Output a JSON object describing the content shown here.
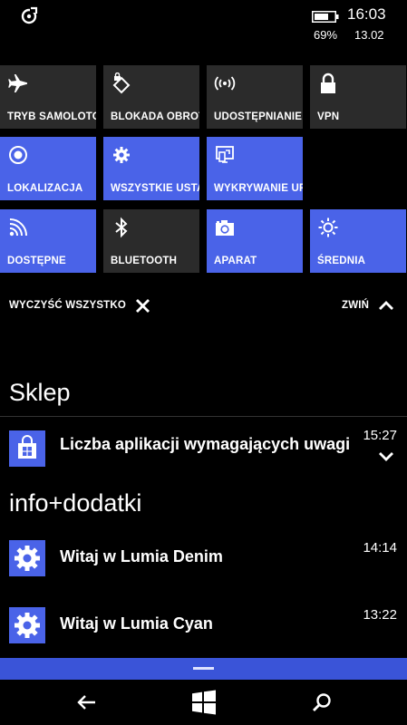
{
  "status": {
    "time": "16:03",
    "battery_pct": "69%",
    "date": "13.02"
  },
  "tiles": [
    {
      "label": "TRYB SAMOLOTOWY",
      "icon": "airplane-icon",
      "color": "gray"
    },
    {
      "label": "BLOKADA OBROTU",
      "icon": "rotation-lock-icon",
      "color": "gray"
    },
    {
      "label": "UDOSTĘPNIANIE",
      "icon": "hotspot-icon",
      "color": "gray"
    },
    {
      "label": "VPN",
      "icon": "lock-icon",
      "color": "gray"
    },
    {
      "label": "LOKALIZACJA",
      "icon": "location-icon",
      "color": "blue"
    },
    {
      "label": "WSZYSTKIE USTAWIENIA",
      "icon": "settings-gear-icon",
      "color": "blue"
    },
    {
      "label": "WYKRYWANIE URZĄDZEŃ",
      "icon": "project-screen-icon",
      "color": "blue"
    },
    {
      "label": "DOSTĘPNE",
      "icon": "wifi-icon",
      "color": "blue"
    },
    {
      "label": "BLUETOOTH",
      "icon": "bluetooth-icon",
      "color": "gray"
    },
    {
      "label": "APARAT",
      "icon": "camera-icon",
      "color": "blue"
    },
    {
      "label": "ŚREDNIA",
      "icon": "brightness-icon",
      "color": "blue"
    }
  ],
  "actions": {
    "clear_all": "WYCZYŚĆ WSZYSTKO",
    "collapse": "ZWIŃ"
  },
  "groups": [
    {
      "title": "Sklep",
      "items": [
        {
          "text": "Liczba aplikacji wymagających uwagi",
          "time": "15:27",
          "icon": "store-bag-icon"
        }
      ]
    },
    {
      "title": "info+dodatki",
      "items": [
        {
          "text": "Witaj w Lumia Denim",
          "time": "14:14",
          "icon": "gear-icon"
        },
        {
          "text": "Witaj w Lumia Cyan",
          "time": "13:22",
          "icon": "gear-icon"
        }
      ]
    }
  ],
  "colors": {
    "accent": "#4a63e8",
    "tile_gray": "#2b2b2b",
    "background": "#000000"
  }
}
